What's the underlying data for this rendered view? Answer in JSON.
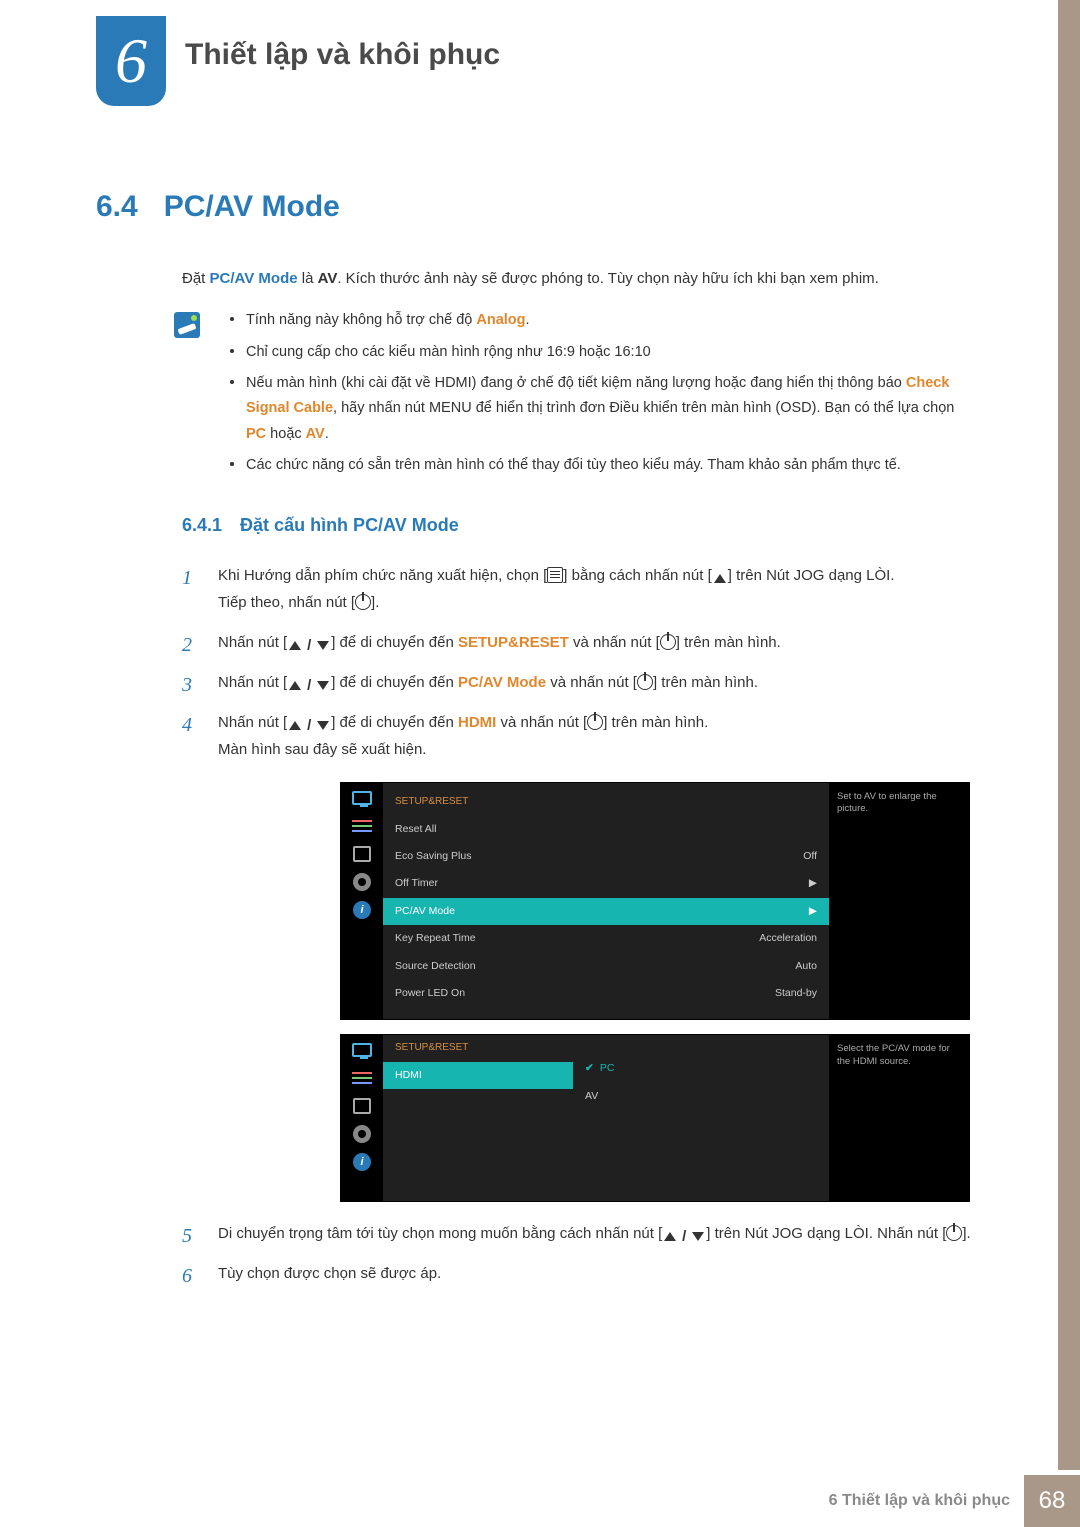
{
  "chapter": {
    "number": "6",
    "title": "Thiết lập và khôi phục"
  },
  "section": {
    "number": "6.4",
    "title": "PC/AV Mode"
  },
  "intro": {
    "pre": "Đặt ",
    "term": "PC/AV Mode",
    "mid": " là ",
    "val": "AV",
    "post": ". Kích thước ảnh này sẽ được phóng to. Tùy chọn này hữu ích khi bạn xem phim."
  },
  "notes": {
    "b1_pre": "Tính năng này không hỗ trợ chế độ ",
    "b1_term": "Analog",
    "b1_post": ".",
    "b2": "Chỉ cung cấp cho các kiểu màn hình rộng như 16:9 hoặc 16:10",
    "b3_pre": "Nếu màn hình (khi cài đặt về HDMI) đang ở chế độ tiết kiệm năng lượng hoặc đang hiển thị thông báo ",
    "b3_term": "Check Signal Cable",
    "b3_mid": ", hãy nhấn nút MENU để hiển thị trình đơn Điều khiển trên màn hình (OSD). Bạn có thể lựa chọn ",
    "b3_pc": "PC",
    "b3_or": " hoặc ",
    "b3_av": "AV",
    "b3_post": ".",
    "b4": "Các chức năng có sẵn trên màn hình có thể thay đổi tùy theo kiểu máy. Tham khảo sản phẩm thực tế."
  },
  "subsection": {
    "number": "6.4.1",
    "title": "Đặt cấu hình PC/AV Mode"
  },
  "steps": {
    "n1": "1",
    "n2": "2",
    "n3": "3",
    "n4": "4",
    "n5": "5",
    "n6": "6",
    "s1a": "Khi Hướng dẫn phím chức năng xuất hiện, chọn [",
    "s1b": "] bằng cách nhấn nút [",
    "s1c": "] trên Nút JOG dạng LÒI.",
    "s1d": "Tiếp theo, nhấn nút [",
    "s1e": "].",
    "s2a": "Nhấn nút [",
    "s2b": "] để di chuyển đến ",
    "s2_term": "SETUP&RESET",
    "s2c": " và nhấn nút [",
    "s2d": "] trên màn hình.",
    "s3a": "Nhấn nút [",
    "s3b": "] để di chuyển đến ",
    "s3_term": "PC/AV Mode",
    "s3c": " và nhấn nút [",
    "s3d": "] trên màn hình.",
    "s4a": "Nhấn nút [",
    "s4b": "] để di chuyển đến ",
    "s4_term": "HDMI",
    "s4c": " và nhấn nút [",
    "s4d": "] trên màn hình.",
    "s4e": "Màn hình sau đây sẽ xuất hiện.",
    "s5a": "Di chuyển trọng tâm tới tùy chọn mong muốn bằng cách nhấn nút [",
    "s5b": "] trên Nút JOG dạng LÒI. Nhấn nút [",
    "s5c": "].",
    "s6": "Tùy chọn được chọn sẽ được áp."
  },
  "slash": "/",
  "osd1": {
    "title": "SETUP&RESET",
    "tip": "Set to AV to enlarge the picture.",
    "rows": [
      {
        "label": "Reset All",
        "value": ""
      },
      {
        "label": "Eco Saving Plus",
        "value": "Off"
      },
      {
        "label": "Off Timer",
        "value": "▶"
      },
      {
        "label": "PC/AV Mode",
        "value": "▶",
        "selected": true
      },
      {
        "label": "Key Repeat Time",
        "value": "Acceleration"
      },
      {
        "label": "Source Detection",
        "value": "Auto"
      },
      {
        "label": "Power LED On",
        "value": "Stand-by"
      }
    ]
  },
  "osd2": {
    "title": "SETUP&RESET",
    "tip": "Select the PC/AV mode for the HDMI source.",
    "left_label": "HDMI",
    "opt_pc": "PC",
    "opt_av": "AV"
  },
  "footer": {
    "text": "6 Thiết lập và khôi phục",
    "page": "68"
  }
}
